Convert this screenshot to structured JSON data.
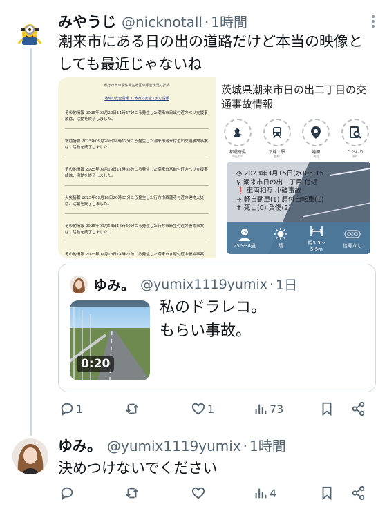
{
  "tweet1": {
    "name": "みやうじ",
    "handle": "@nicknotall",
    "dot": "·",
    "time": "1時間",
    "text": "潮来市にある日の出の道路だけど本当の映像としても最近じゃないね",
    "actions": {
      "reply_count": "1",
      "retweet_count": "",
      "like_count": "1",
      "view_count": "73"
    }
  },
  "doc": {
    "title": "県は日本の事件発生地区の報告状況の詳細",
    "links": "地域の安全情報 ・ 教育の安全・安心情報",
    "paragraphs": [
      "その他情報 2025年09月20日14時47分ころ発生した潮来市日出付近のベリ支援事故は、活動を終了しました。",
      "救助情報 2025年09月20日14時12分ころ発生した潮来市潮来付近の交通事故事案は、活動を終了しました。",
      "その他情報 2025年09月19日11時55分ころ発生した潮来市宮前付近のベリ支援事故は、活動を終了しました。",
      "火災情報 2025年09月18日20時05分ころ発生した行方市西蓮寺付近の建物火災は、活動を終了しました。",
      "その他情報 2025年09月18日16時40分ころ発生した行方市麻生付近の警戒事案は、活動を終了しました。",
      "その他情報 2025年09月18日14時22分ころ発生した潮来市水原付近の警戒事案は、活動を終了しました。"
    ]
  },
  "accident_app": {
    "title": "茨城県潮来市日の出二丁目の交通事故情報",
    "categories": [
      {
        "label": "都道府県",
        "sub": "市区町村",
        "icon": "map-prefecture-icon"
      },
      {
        "label": "沿線・駅",
        "sub": "路線",
        "icon": "train-icon"
      },
      {
        "label": "地図",
        "sub": "周辺",
        "icon": "map-pin-icon"
      },
      {
        "label": "こだわり",
        "sub": "条件",
        "icon": "search-doc-icon"
      }
    ],
    "date": "2023年3月15日(水)05:15",
    "place": "潮来市日の出二丁目 付近",
    "type": "車両相互 小破事故",
    "parties": "軽自動車(1) 原付自転車(1)",
    "casualties": "死亡(0) 負傷(2)",
    "conditions": [
      {
        "label": "25〜34歳",
        "icon": "age-icon",
        "badge": "-34"
      },
      {
        "label": "晴",
        "icon": "sun-icon"
      },
      {
        "label": "幅3.5〜5.5m",
        "icon": "road-width-icon"
      },
      {
        "label": "信号なし",
        "icon": "no-signal-icon"
      }
    ]
  },
  "quote": {
    "name": "ゆみ。",
    "handle": "@yumix1119yumix",
    "dot": "·",
    "time": "1日",
    "duration": "0:20",
    "text_line1": "私のドラレコ。",
    "text_line2": "もらい事故。"
  },
  "tweet2": {
    "name": "ゆみ。",
    "handle": "@yumix1119yumix",
    "dot": "·",
    "time": "1時間",
    "text": "決めつけないでください",
    "actions": {
      "reply_count": "",
      "retweet_count": "",
      "like_count": "",
      "view_count": "4"
    }
  },
  "colors": {
    "muted": "#536471",
    "line": "#cfd9de",
    "accent_blue": "#4c789b"
  }
}
